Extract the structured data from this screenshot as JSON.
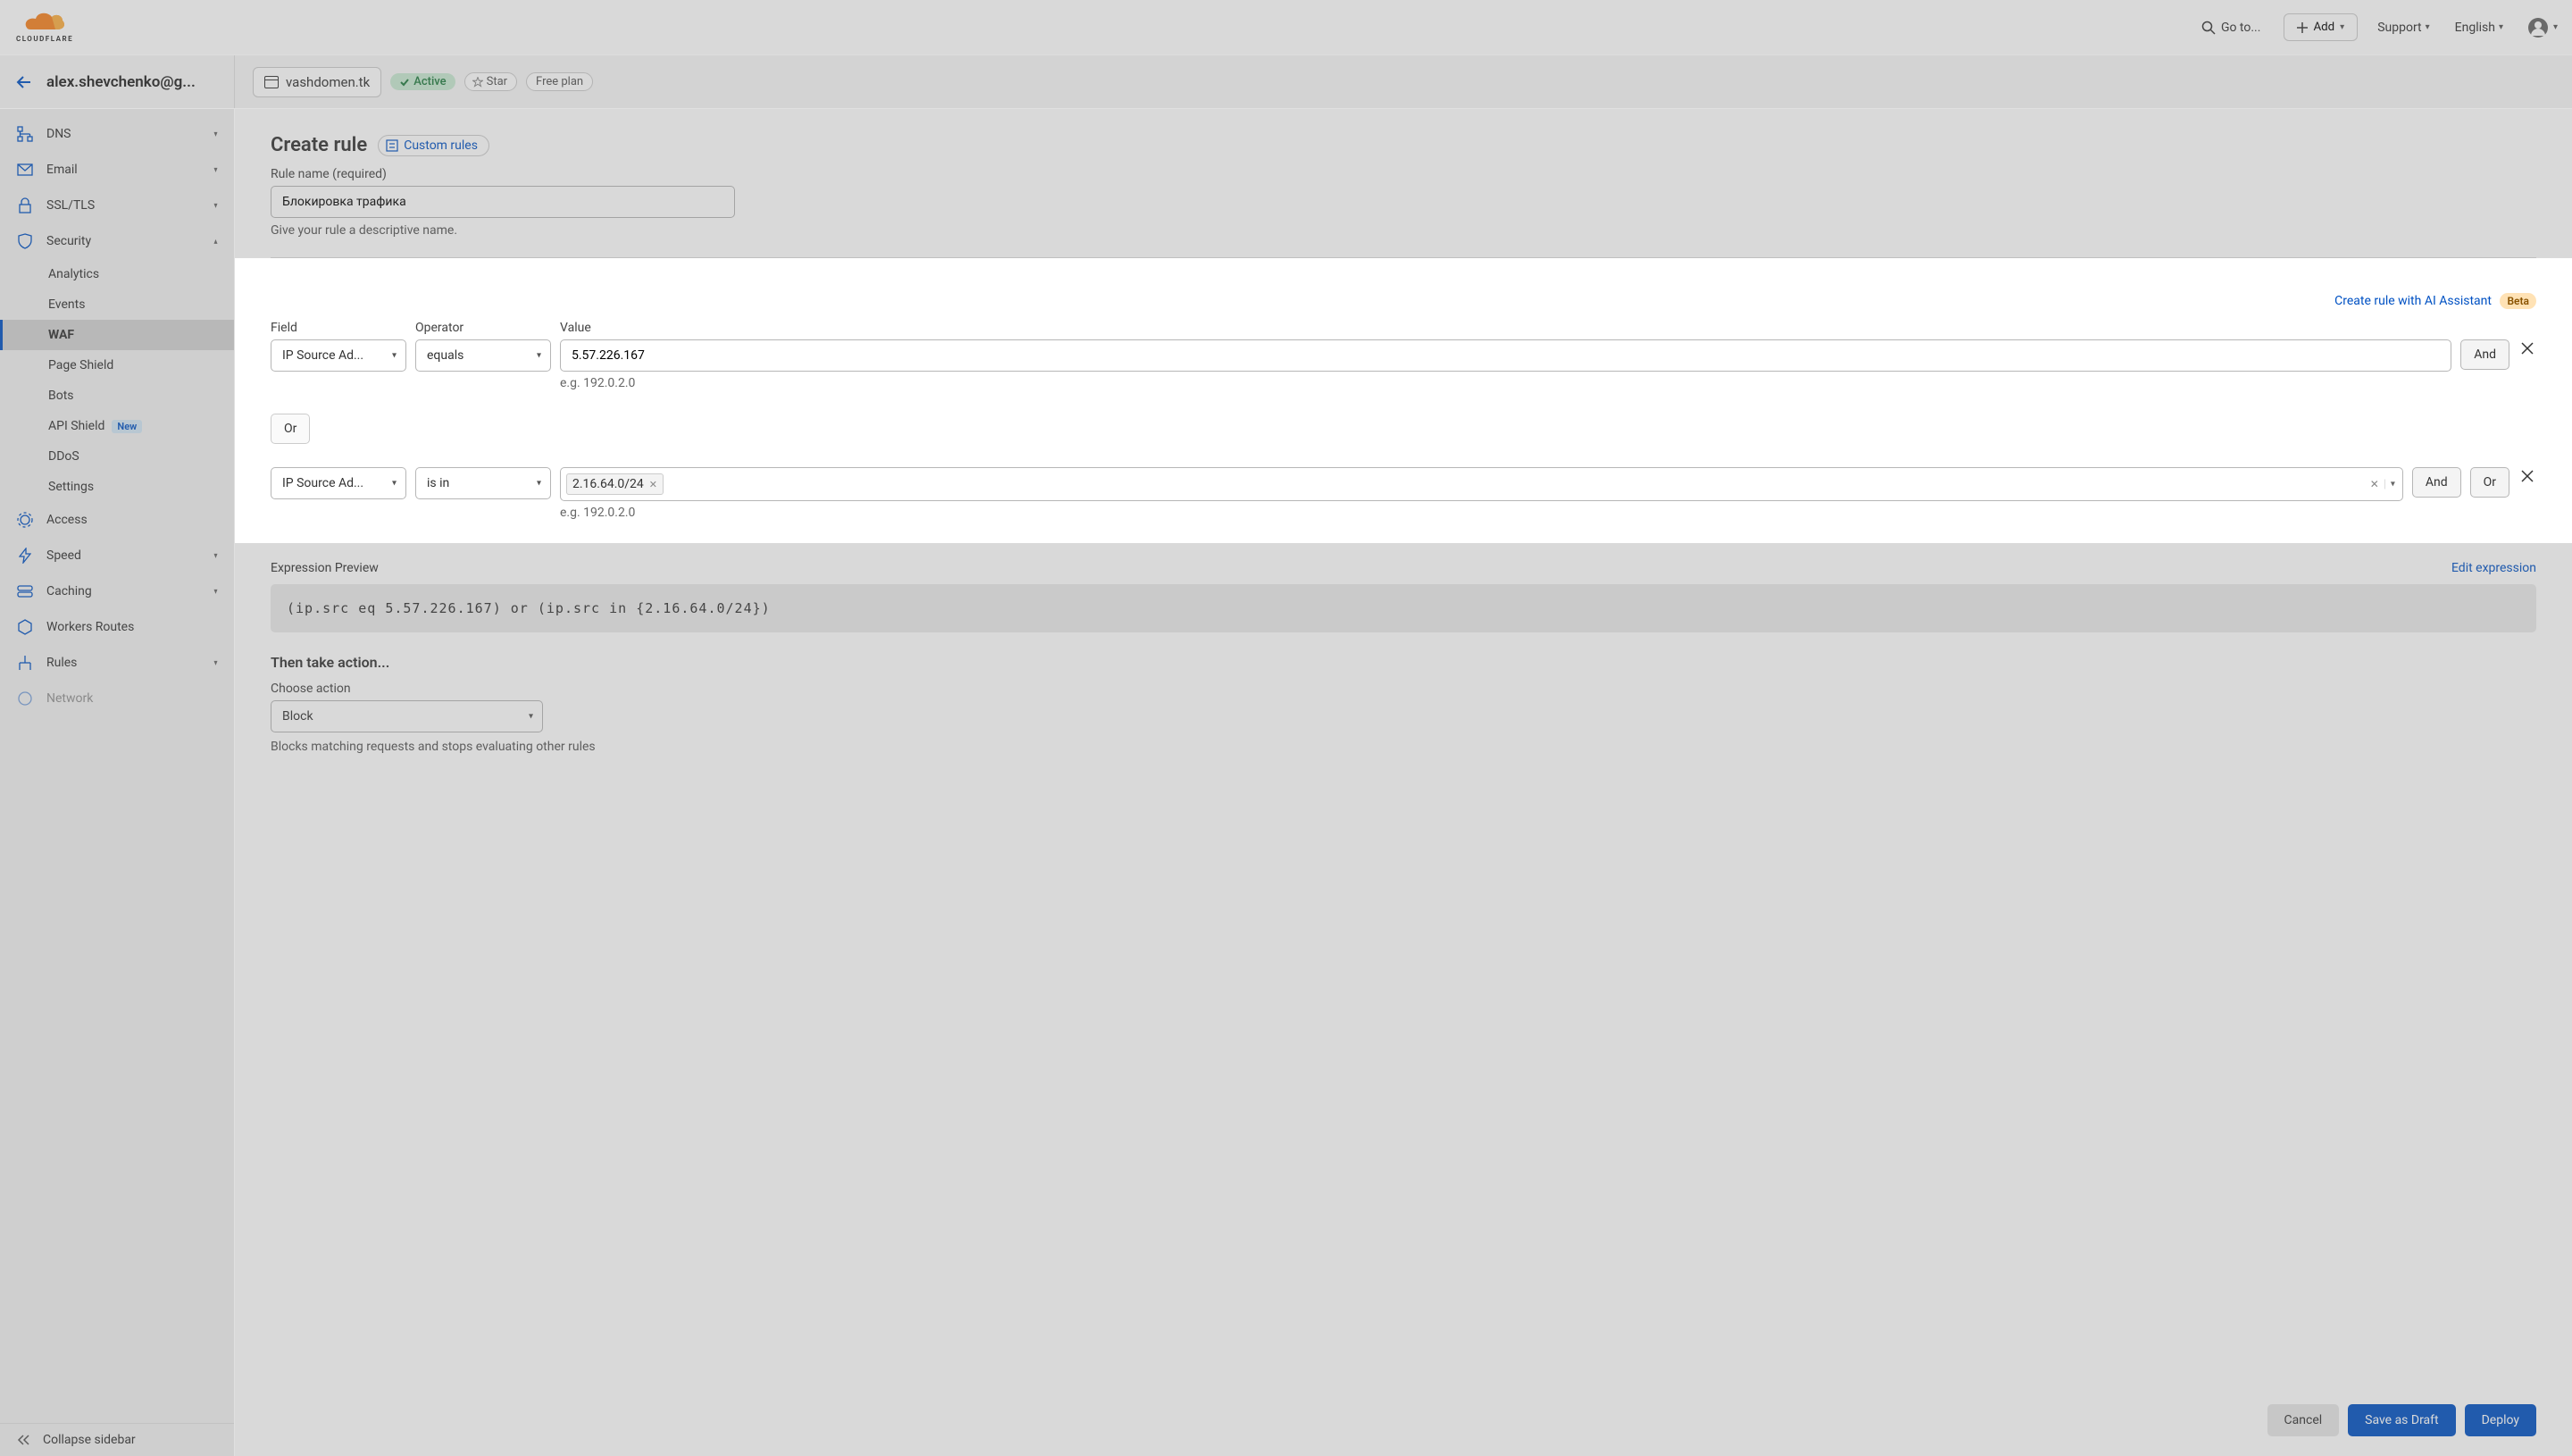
{
  "brand": {
    "name": "CLOUDFLARE"
  },
  "top": {
    "goto": "Go to...",
    "add": "Add",
    "support": "Support",
    "language": "English"
  },
  "account": {
    "email": "alex.shevchenko@g...",
    "zone": "vashdomen.tk",
    "active": "Active",
    "star": "Star",
    "plan": "Free plan"
  },
  "nav": {
    "dns": "DNS",
    "email": "Email",
    "ssl": "SSL/TLS",
    "security": "Security",
    "sec_sub": {
      "analytics": "Analytics",
      "events": "Events",
      "waf": "WAF",
      "page_shield": "Page Shield",
      "bots": "Bots",
      "api_shield": "API Shield",
      "api_new": "New",
      "ddos": "DDoS",
      "settings": "Settings"
    },
    "access": "Access",
    "speed": "Speed",
    "caching": "Caching",
    "workers": "Workers Routes",
    "rules": "Rules",
    "network": "Network",
    "collapse": "Collapse sidebar"
  },
  "page": {
    "title": "Create rule",
    "breadcrumb": "Custom rules",
    "name_label": "Rule name (required)",
    "name_value": "Блокировка трафика",
    "name_hint": "Give your rule a descriptive name."
  },
  "builder": {
    "ai_link": "Create rule with AI Assistant",
    "ai_badge": "Beta",
    "headers": {
      "field": "Field",
      "operator": "Operator",
      "value": "Value"
    },
    "row1": {
      "field": "IP Source Ad...",
      "op": "equals",
      "value": "5.57.226.167",
      "hint": "e.g. 192.0.2.0",
      "and": "And"
    },
    "or_btn": "Or",
    "row2": {
      "field": "IP Source Ad...",
      "op": "is in",
      "chip": "2.16.64.0/24",
      "hint": "e.g. 192.0.2.0",
      "and": "And",
      "or": "Or"
    }
  },
  "expr": {
    "title": "Expression Preview",
    "edit": "Edit expression",
    "code": "(ip.src eq 5.57.226.167) or (ip.src in {2.16.64.0/24})"
  },
  "action": {
    "title": "Then take action...",
    "label": "Choose action",
    "value": "Block",
    "hint": "Blocks matching requests and stops evaluating other rules"
  },
  "footer": {
    "cancel": "Cancel",
    "draft": "Save as Draft",
    "deploy": "Deploy"
  }
}
